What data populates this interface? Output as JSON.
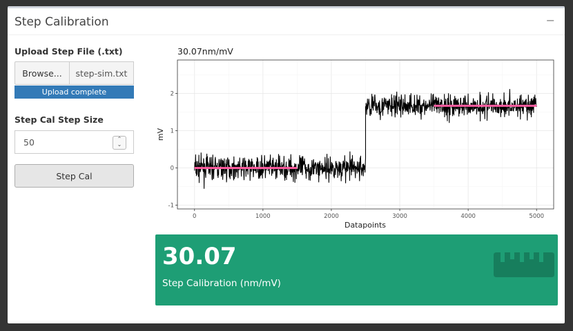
{
  "box": {
    "title": "Step Calibration",
    "collapse_icon": "−"
  },
  "upload": {
    "label": "Upload Step File (.txt)",
    "browse_label": "Browse...",
    "file_name": "step-sim.txt",
    "progress_text": "Upload complete",
    "progress_fraction": 1.0
  },
  "stepsize": {
    "label": "Step Cal Step Size",
    "value": "50"
  },
  "stepcal_button": "Step Cal",
  "plot": {
    "title": "30.07nm/mV",
    "ylabel": "mV",
    "xlabel": "Datapoints",
    "x_ticks": [
      "0",
      "1000",
      "2000",
      "3000",
      "4000",
      "5000"
    ],
    "y_ticks": [
      "-1",
      "0",
      "1",
      "2"
    ]
  },
  "chart_data": {
    "type": "line",
    "title": "30.07nm/mV",
    "xlabel": "Datapoints",
    "ylabel": "mV",
    "xlim": [
      -250,
      5250
    ],
    "ylim": [
      -1.1,
      2.9
    ],
    "grid": true,
    "series": [
      {
        "segments": [
          {
            "x": [
              0,
              2500
            ],
            "mean": 0.0,
            "noise_range": [
              -0.95,
              0.55
            ]
          },
          {
            "x": [
              2500,
              5000
            ],
            "mean": 1.67,
            "noise_range": [
              0.75,
              2.75
            ]
          }
        ],
        "color": "#000000"
      },
      {
        "segments": [
          {
            "x": [
              0,
              1500
            ],
            "y": 0.0
          },
          {
            "x": [
              3500,
              5000
            ],
            "y": 1.67
          }
        ],
        "color": "#ff5ba0"
      }
    ]
  },
  "valuebox": {
    "value": "30.07",
    "subtitle": "Step Calibration (nm/mV)",
    "icon": "ruler-icon",
    "color": "#1e9e75"
  }
}
